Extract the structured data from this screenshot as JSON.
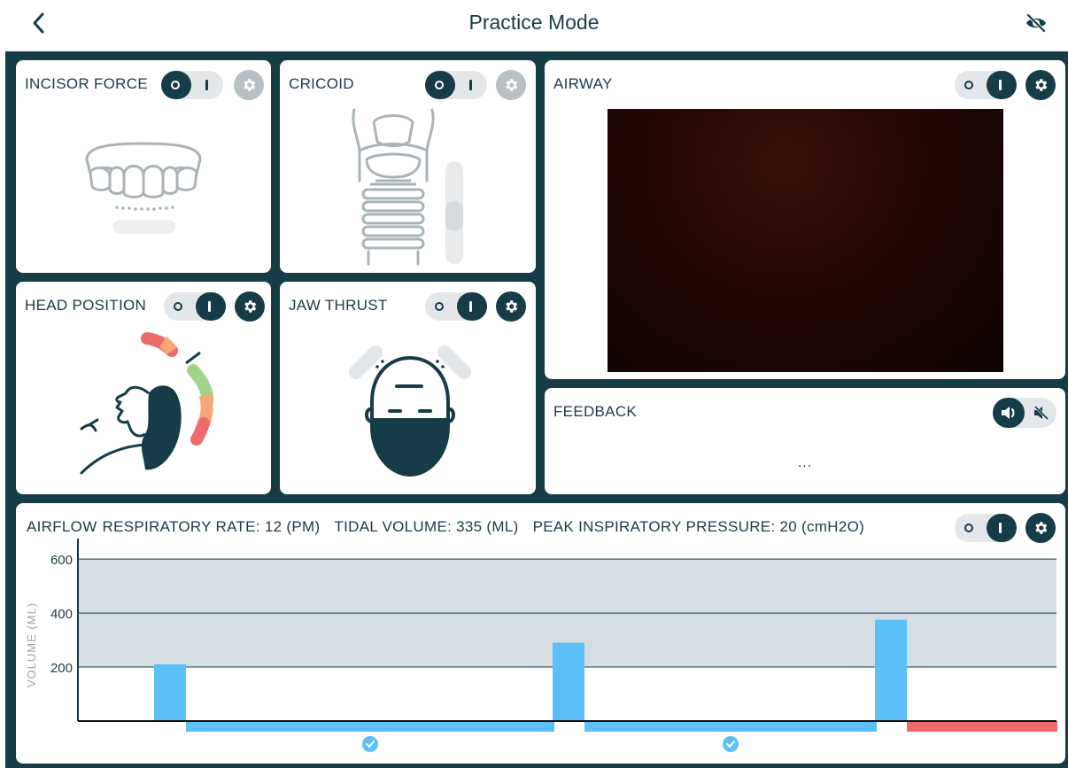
{
  "header": {
    "title": "Practice Mode",
    "back_icon": "chevron-left-icon",
    "visibility_icon": "eye-off-icon"
  },
  "panels": {
    "incisor": {
      "title": "INCISOR FORCE",
      "toggle": "off",
      "settings_enabled": false
    },
    "cricoid": {
      "title": "CRICOID",
      "toggle": "off",
      "settings_enabled": false
    },
    "airway": {
      "title": "AIRWAY",
      "toggle": "on",
      "settings_enabled": true
    },
    "head": {
      "title": "HEAD POSITION",
      "toggle": "on",
      "settings_enabled": true
    },
    "jaw": {
      "title": "JAW THRUST",
      "toggle": "on",
      "settings_enabled": true
    },
    "feedback": {
      "title": "FEEDBACK",
      "message": "...",
      "sound": "on"
    }
  },
  "airflow": {
    "title": "AIRFLOW",
    "respiratory_rate": "RESPIRATORY RATE: 12 (PM)",
    "tidal_volume": "TIDAL VOLUME: 335 (ML)",
    "peak_pressure": "PEAK INSPIRATORY PRESSURE: 20 (cmH2O)",
    "toggle": "on",
    "settings_enabled": true
  },
  "colors": {
    "primary": "#163c47",
    "bar": "#5bc0f8",
    "target_band": "#d3dde2",
    "alert": "#ef6b6b"
  },
  "chart_data": {
    "type": "bar",
    "ylabel": "VOLUME (ML)",
    "yticks": [
      200,
      400,
      600
    ],
    "ylim": [
      0,
      630
    ],
    "target_band": [
      200,
      600
    ],
    "breaths": [
      {
        "volume": 210,
        "status": "ok"
      },
      {
        "volume": 290,
        "status": "ok"
      },
      {
        "volume": 375,
        "status": "alert"
      }
    ]
  }
}
